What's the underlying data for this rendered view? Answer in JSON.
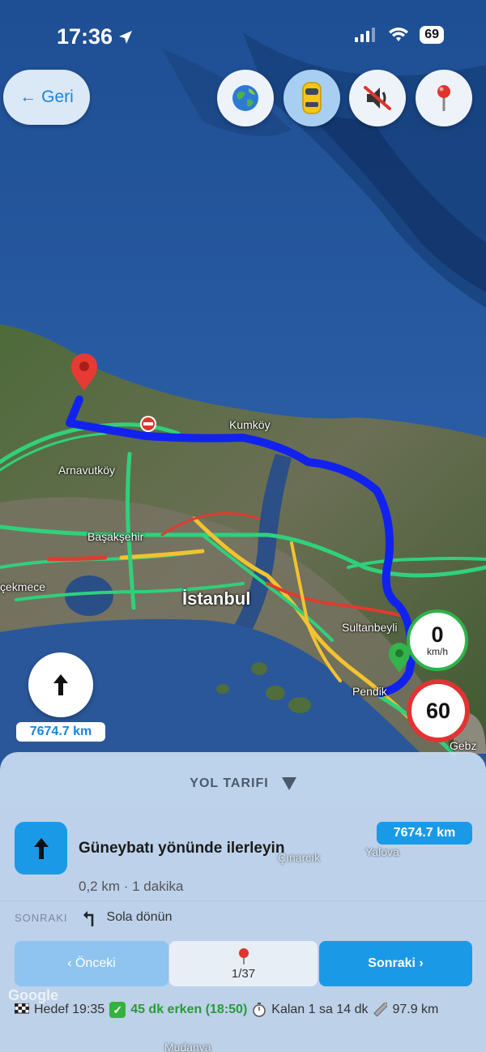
{
  "status_bar": {
    "time": "17:36",
    "battery": "69"
  },
  "toolbar": {
    "back_label": "Geri",
    "buttons": [
      {
        "name": "globe-button",
        "icon": "globe-icon"
      },
      {
        "name": "car-button",
        "icon": "car-icon",
        "active": true
      },
      {
        "name": "mute-button",
        "icon": "speaker-muted-icon"
      },
      {
        "name": "pin-button",
        "icon": "pin-icon"
      }
    ]
  },
  "map": {
    "labels": [
      "Kumköy",
      "Arnavutköy",
      "Başakşehir",
      "çekmece",
      "İstanbul",
      "Sultanbeyli",
      "Pendik",
      "Gebz",
      "Çınarcık",
      "Yalova",
      "Mudanya"
    ],
    "route_color": "#1122ee"
  },
  "overlay": {
    "distance": "7674.7 km",
    "current_speed": "0",
    "speed_unit": "km/h",
    "speed_limit": "60"
  },
  "directions": {
    "title": "YOL TARIFI",
    "step_text": "Güneybatı yönünde ilerleyin",
    "step_distance": "7674.7 km",
    "step_sub": "0,2 km · 1 dakika",
    "next_label": "SONRAKI",
    "next_text": "Sola dönün",
    "prev_button": "‹ Önceki",
    "next_button": "Sonraki ›",
    "page": "1/37",
    "watermark": "Google"
  },
  "footer": {
    "destination": "Hedef 19:35",
    "early": "45 dk erken (18:50)",
    "remaining": "Kalan 1 sa 14 dk",
    "total": "97.9 km"
  }
}
